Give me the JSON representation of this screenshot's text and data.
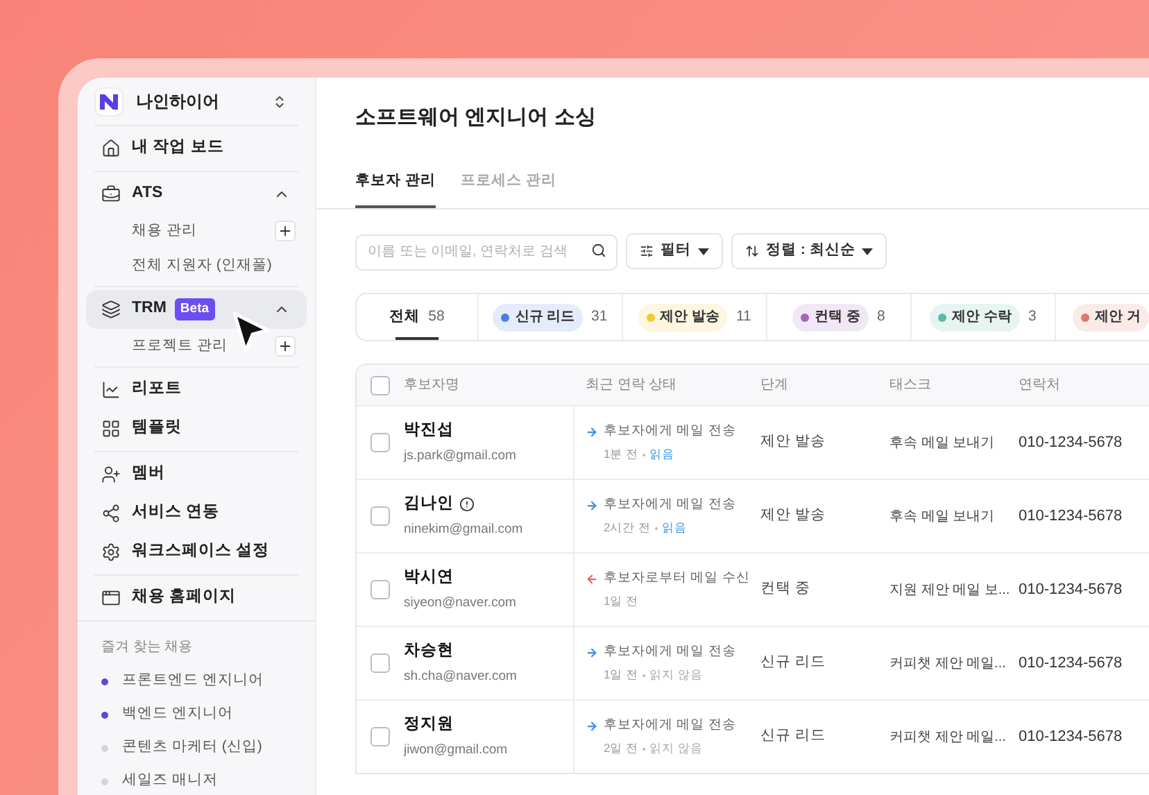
{
  "workspace": {
    "name": "나인하이어"
  },
  "nav_sections": [
    [
      {
        "kind": "link",
        "label": "내 작업 보드"
      }
    ],
    [
      {
        "kind": "group",
        "label": "ATS",
        "selected": false,
        "expanded": true,
        "children": [
          {
            "label": "채용 관리",
            "add_button": true
          },
          {
            "label": "전체 지원자 (인재풀)",
            "add_button": false
          }
        ]
      }
    ],
    [
      {
        "kind": "group",
        "label": "TRM",
        "badge": "Beta",
        "selected": true,
        "expanded": true,
        "children": [
          {
            "label": "프로젝트 관리",
            "add_button": true
          }
        ]
      }
    ],
    [
      {
        "kind": "link",
        "label": "리포트"
      },
      {
        "kind": "link",
        "label": "템플릿"
      }
    ],
    [
      {
        "kind": "link",
        "label": "멤버"
      },
      {
        "kind": "link",
        "label": "서비스 연동"
      },
      {
        "kind": "link",
        "label": "워크스페이스 설정"
      }
    ],
    [
      {
        "kind": "link",
        "label": "채용 홈페이지"
      }
    ]
  ],
  "favorites": {
    "title": "즐겨 찾는 채용",
    "items": [
      {
        "label": "프론트엔드 엔지니어",
        "color": "#5b4ad6"
      },
      {
        "label": "백엔드 엔지니어",
        "color": "#5b4ad6"
      },
      {
        "label": "콘텐츠 마케터 (신입)",
        "color": "#d4d5da"
      },
      {
        "label": "세일즈 매니저",
        "color": "#d4d5da"
      }
    ]
  },
  "page_title": "소프트웨어 엔지니어 소싱",
  "tabs": [
    {
      "label": "후보자 관리",
      "selected": true
    },
    {
      "label": "프로세스 관리",
      "selected": false
    }
  ],
  "search": {
    "placeholder": "이름 또는 이메일, 연락처로 검색"
  },
  "filter_button": "필터",
  "sort_button": "정렬 : 최신순",
  "stage_tabs": [
    {
      "label": "전체",
      "count": "58",
      "selected": true
    },
    {
      "label": "신규 리드",
      "count": "31",
      "color": "#4c7fe6",
      "selected": false
    },
    {
      "label": "제안 발송",
      "count": "11",
      "color": "#f2c935",
      "selected": false
    },
    {
      "label": "컨택 중",
      "count": "8",
      "color": "#a964ba",
      "selected": false
    },
    {
      "label": "제안 수락",
      "count": "3",
      "color": "#5cb8a8",
      "selected": false
    },
    {
      "label": "제안 거",
      "color": "#e07868",
      "selected": false
    }
  ],
  "table": {
    "all_checked": false,
    "columns": [
      "후보자명",
      "최근 연락 상태",
      "단계",
      "태스크",
      "연락처"
    ],
    "rows": [
      {
        "checked": false,
        "name": "박진섭",
        "alert": false,
        "email": "js.park@gmail.com",
        "contact": {
          "kind": "outgoing",
          "text": "후보자에게 메일 전송",
          "time": "1분 전",
          "read_label": "읽음",
          "read": true
        },
        "stage": "제안 발송",
        "task": "후속 메일 보내기",
        "phone": "010-1234-5678"
      },
      {
        "checked": false,
        "name": "김나인",
        "alert": true,
        "email": "ninekim@gmail.com",
        "contact": {
          "kind": "outgoing",
          "text": "후보자에게 메일 전송",
          "time": "2시간 전",
          "read_label": "읽음",
          "read": true
        },
        "stage": "제안 발송",
        "task": "후속 메일 보내기",
        "phone": "010-1234-5678"
      },
      {
        "checked": false,
        "name": "박시연",
        "alert": false,
        "email": "siyeon@naver.com",
        "contact": {
          "kind": "incoming",
          "text": "후보자로부터 메일 수신",
          "time": "1일 전"
        },
        "stage": "컨택 중",
        "task": "지원 제안 메일 보...",
        "phone": "010-1234-5678"
      },
      {
        "checked": false,
        "name": "차승현",
        "alert": false,
        "email": "sh.cha@naver.com",
        "contact": {
          "kind": "outgoing",
          "text": "후보자에게 메일 전송",
          "time": "1일 전",
          "read_label": "읽지 않음",
          "read": false
        },
        "stage": "신규 리드",
        "task": "커피챗 제안 메일...",
        "phone": "010-1234-5678"
      },
      {
        "checked": false,
        "name": "정지원",
        "alert": false,
        "email": "jiwon@gmail.com",
        "contact": {
          "kind": "outgoing",
          "text": "후보자에게 메일 전송",
          "time": "2일 전",
          "read_label": "읽지 않음",
          "read": false
        },
        "stage": "신규 리드",
        "task": "커피챗 제안 메일...",
        "phone": "010-1234-5678"
      }
    ]
  }
}
